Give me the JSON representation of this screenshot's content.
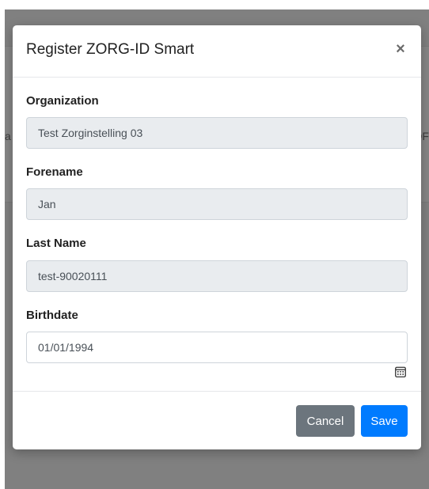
{
  "modal": {
    "title": "Register ZORG-ID Smart",
    "close_label": "×"
  },
  "form": {
    "organization": {
      "label": "Organization",
      "value": "Test Zorginstelling 03"
    },
    "forename": {
      "label": "Forename",
      "value": "Jan"
    },
    "last_name": {
      "label": "Last Name",
      "value": "test-90020111"
    },
    "birthdate": {
      "label": "Birthdate",
      "value": "01/01/1994",
      "icon": "calendar-icon"
    }
  },
  "footer": {
    "cancel_label": "Cancel",
    "save_label": "Save"
  },
  "background": {
    "left_fragment": "a",
    "right_fragment": "OF"
  },
  "colors": {
    "primary": "#007bff",
    "secondary": "#6c757d",
    "readonly_field": "#e9ecef"
  }
}
